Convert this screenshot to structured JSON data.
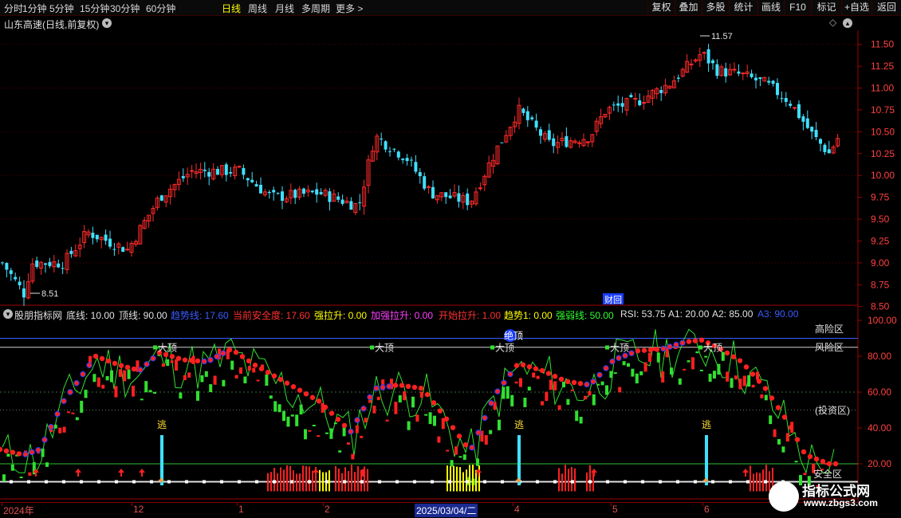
{
  "toolbar": {
    "left_items": [
      "分时",
      "1分钟",
      "5分钟",
      "15分钟",
      "30分钟",
      "60分钟",
      "日线",
      "周线",
      "月线",
      "多周期",
      "更多 >"
    ],
    "active_item": "日线",
    "right_items": [
      "复权",
      "叠加",
      "多股",
      "统计",
      "画线",
      "F10",
      "标记",
      "+自选",
      "返回"
    ]
  },
  "main_panel": {
    "title": "山东高速(日线,前复权)",
    "high_label": "11.57",
    "low_label": "8.51",
    "finance_badge": "财回",
    "y_ticks": [
      "11.50",
      "11.25",
      "11.00",
      "10.75",
      "10.50",
      "10.25",
      "10.00",
      "9.75",
      "9.50",
      "9.25",
      "9.00",
      "8.75",
      "8.50"
    ]
  },
  "indicator_bar": [
    {
      "text": "股朋指标网",
      "color": "#e0e0e0"
    },
    {
      "text": "底线: 10.00",
      "color": "#e0e0e0"
    },
    {
      "text": "顶线: 90.00",
      "color": "#e0e0e0"
    },
    {
      "text": "趋势线: 17.60",
      "color": "#3b5bff"
    },
    {
      "text": "当前安全度: 17.60",
      "color": "#ff3030"
    },
    {
      "text": "强拉升: 0.00",
      "color": "#ffff00"
    },
    {
      "text": "加强拉升: 0.00",
      "color": "#ff40ff"
    },
    {
      "text": "开始拉升: 1.00",
      "color": "#ff3030"
    },
    {
      "text": "趋势1: 0.00",
      "color": "#ffff00"
    },
    {
      "text": "强弱线: 50.00",
      "color": "#30ff30"
    },
    {
      "text": "RSI: 53.75",
      "color": "#e0e0e0"
    },
    {
      "text": "A1: 20.00",
      "color": "#e0e0e0"
    },
    {
      "text": "A2: 85.00",
      "color": "#e0e0e0"
    },
    {
      "text": "A3: 90.00",
      "color": "#3b5bff"
    }
  ],
  "sub_panel": {
    "y_ticks": [
      "100.00",
      "80.00",
      "60.00",
      "40.00",
      "20.00"
    ],
    "zones": {
      "high": "高险区",
      "risk": "风险区",
      "invest": "(投资区)",
      "safe": "安全区"
    },
    "top_labels": [
      "大顶",
      "大顶",
      "大顶",
      "大顶",
      "大顶"
    ],
    "escape_labels": [
      "逃",
      "逃",
      "逃"
    ],
    "extra_label": "绝顶"
  },
  "dates": {
    "labels": [
      "2024年",
      "12",
      "1",
      "2",
      "4",
      "5",
      "6"
    ],
    "selected": "2025/03/04/二"
  },
  "watermark": {
    "line1": "指标公式网",
    "line2": "www.zbgs3.com"
  },
  "colors": {
    "up": "#ff2a2a",
    "down": "#40e0ff",
    "grid": "#800000",
    "safety": "#ff2020",
    "trend": "#1a3cff",
    "strength": "#30ff30"
  }
}
